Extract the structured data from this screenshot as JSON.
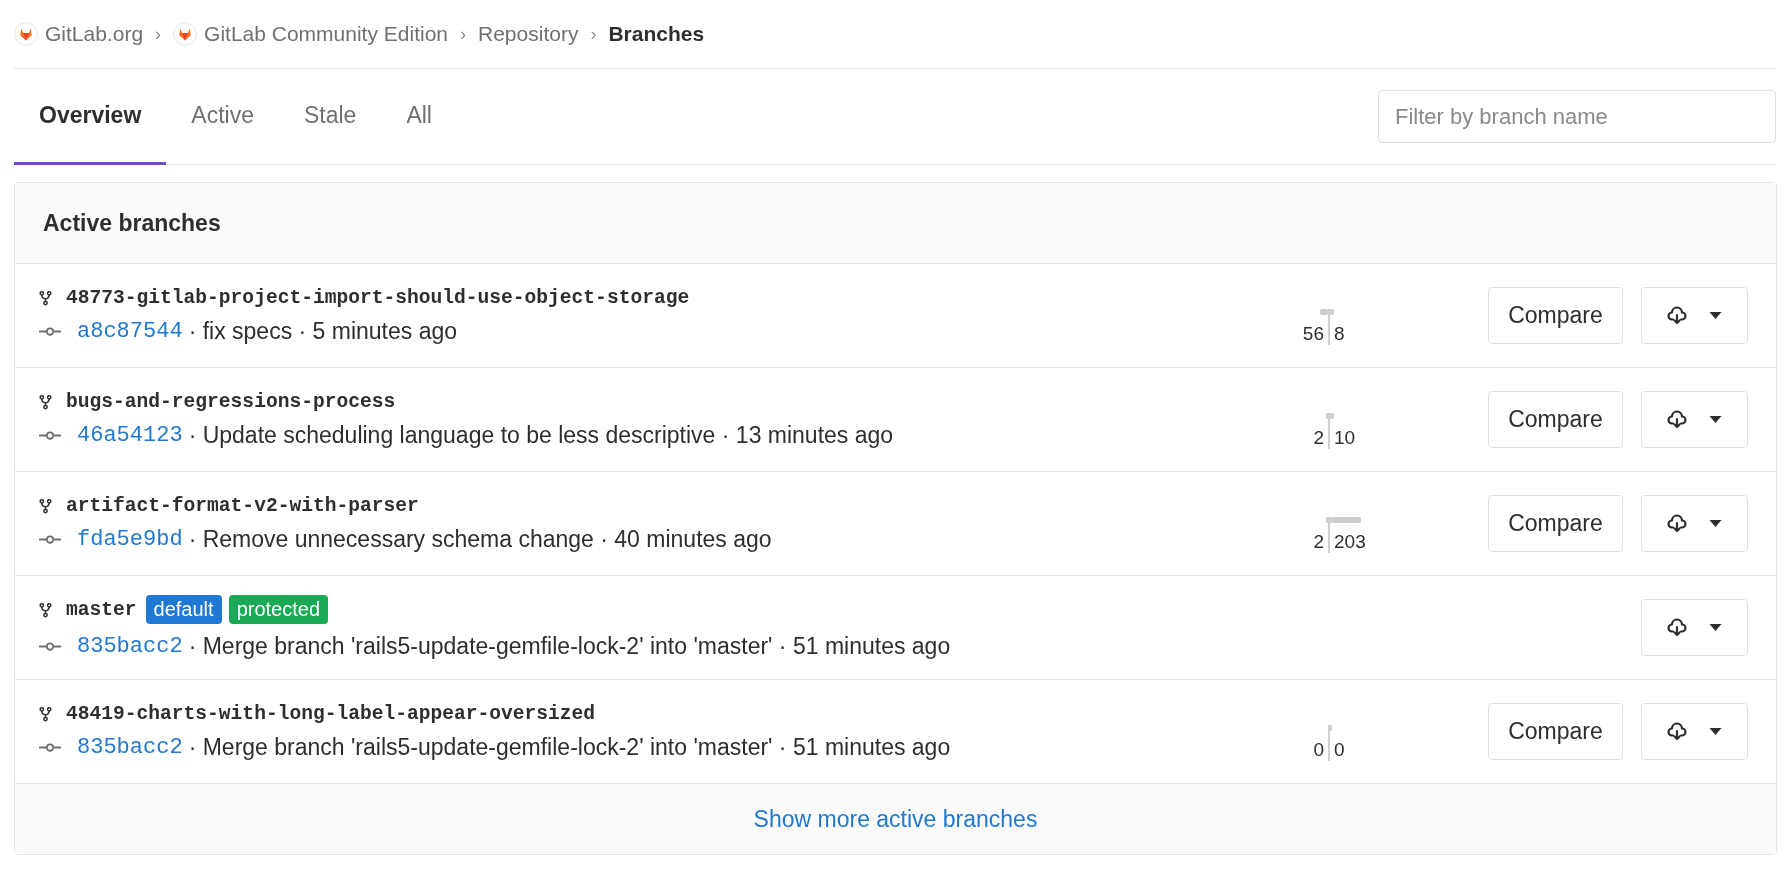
{
  "breadcrumbs": [
    {
      "label": "GitLab.org",
      "kind": "group",
      "current": false
    },
    {
      "label": "GitLab Community Edition",
      "kind": "group",
      "current": false
    },
    {
      "label": "Repository",
      "kind": "plain",
      "current": false
    },
    {
      "label": "Branches",
      "kind": "plain",
      "current": true
    }
  ],
  "separator": "›",
  "tabs": [
    {
      "label": "Overview",
      "selected": true
    },
    {
      "label": "Active",
      "selected": false
    },
    {
      "label": "Stale",
      "selected": false
    },
    {
      "label": "All",
      "selected": false
    }
  ],
  "search": {
    "placeholder": "Filter by branch name"
  },
  "panel": {
    "title": "Active branches",
    "footer_link": "Show more active branches",
    "branches": [
      {
        "name": "48773-gitlab-project-import-should-use-object-storage",
        "sha": "a8c87544",
        "info": "· fix specs · 5 minutes ago",
        "divergence": {
          "behind": {
            "count": "56"
          },
          "ahead": {
            "count": "8"
          }
        },
        "compare": "Compare"
      },
      {
        "name": "bugs-and-regressions-process",
        "sha": "46a54123",
        "info": "· Update scheduling language to be less descriptive · 13 minutes ago",
        "divergence": {
          "behind": {
            "count": "2"
          },
          "ahead": {
            "count": "10"
          }
        },
        "compare": "Compare"
      },
      {
        "name": "artifact-format-v2-with-parser",
        "sha": "fda5e9bd",
        "info": "· Remove unnecessary schema change · 40 minutes ago",
        "divergence": {
          "behind": {
            "count": "2"
          },
          "ahead": {
            "count": "203"
          }
        },
        "compare": "Compare"
      },
      {
        "name": "master",
        "badges": [
          {
            "label": "default",
            "color": "#1f78d1"
          },
          {
            "label": "protected",
            "color": "#1aaa55"
          }
        ],
        "sha": "835bacc2",
        "info": "· Merge branch 'rails5-update-gemfile-lock-2' into 'master' · 51 minutes ago"
      },
      {
        "name": "48419-charts-with-long-label-appear-oversized",
        "sha": "835bacc2",
        "info": "· Merge branch 'rails5-update-gemfile-lock-2' into 'master' · 51 minutes ago",
        "divergence": {
          "behind": {
            "count": "0"
          },
          "ahead": {
            "count": "0"
          }
        },
        "compare": "Compare"
      }
    ]
  }
}
